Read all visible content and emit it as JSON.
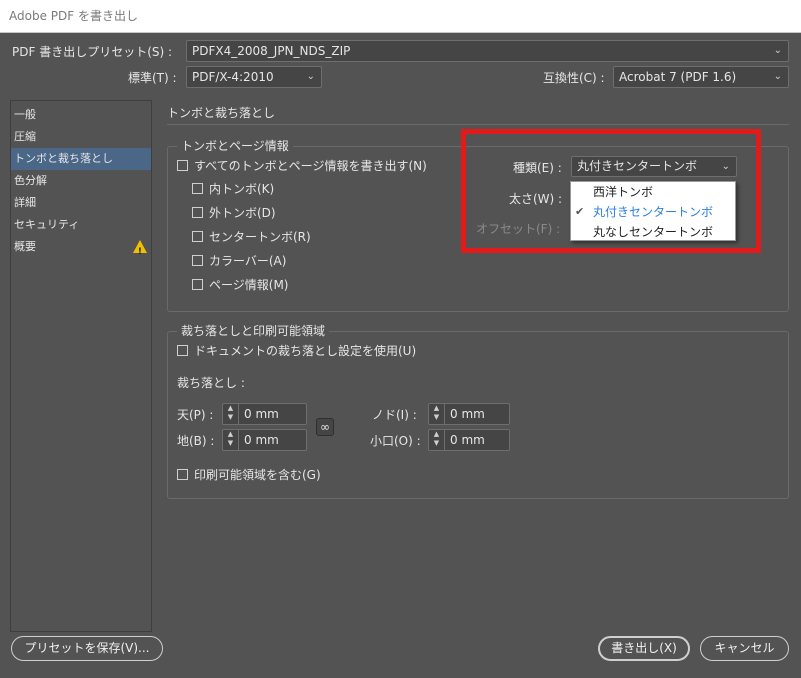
{
  "window": {
    "title": "Adobe PDF を書き出し"
  },
  "preset": {
    "label": "PDF 書き出しプリセット(S) :",
    "value": "PDFX4_2008_JPN_NDS_ZIP"
  },
  "standard": {
    "label": "標準(T) :",
    "value": "PDF/X-4:2010"
  },
  "compat": {
    "label": "互換性(C) :",
    "value": "Acrobat 7 (PDF 1.6)"
  },
  "sidebar": {
    "items": [
      {
        "label": "一般"
      },
      {
        "label": "圧縮"
      },
      {
        "label": "トンボと裁ち落とし"
      },
      {
        "label": "色分解"
      },
      {
        "label": "詳細"
      },
      {
        "label": "セキュリティ"
      },
      {
        "label": "概要"
      }
    ],
    "warning_icon": "warning-triangle-icon"
  },
  "section_title": "トンボと裁ち落とし",
  "marks": {
    "group_title": "トンボとページ情報",
    "all": "すべてのトンボとページ情報を書き出す(N)",
    "options": [
      {
        "label": "内トンボ(K)"
      },
      {
        "label": "外トンボ(D)"
      },
      {
        "label": "センタートンボ(R)"
      },
      {
        "label": "カラーバー(A)"
      },
      {
        "label": "ページ情報(M)"
      }
    ],
    "type_label": "種類(E) :",
    "type_value": "丸付きセンタートンボ",
    "weight_label": "太さ(W) :",
    "offset_label": "オフセット(F) :",
    "dropdown_options": [
      {
        "label": "西洋トンボ",
        "selected": false
      },
      {
        "label": "丸付きセンタートンボ",
        "selected": true
      },
      {
        "label": "丸なしセンタートンボ",
        "selected": false
      }
    ],
    "check_glyph": "✔"
  },
  "bleed": {
    "group_title": "裁ち落としと印刷可能領域",
    "use_doc": "ドキュメントの裁ち落とし設定を使用(U)",
    "bleed_label": "裁ち落とし :",
    "top_label": "天(P) :",
    "top_value": "0 mm",
    "bottom_label": "地(B) :",
    "bottom_value": "0 mm",
    "inside_label": "ノド(I) :",
    "inside_value": "0 mm",
    "outside_label": "小口(O) :",
    "outside_value": "0 mm",
    "slug": "印刷可能領域を含む(G)"
  },
  "buttons": {
    "save_preset": "プリセットを保存(V)...",
    "export": "書き出し(X)",
    "cancel": "キャンセル"
  },
  "colors": {
    "accent": "#4a6788",
    "highlight": "#e21a1a",
    "selected_option": "#2b7fe0"
  }
}
